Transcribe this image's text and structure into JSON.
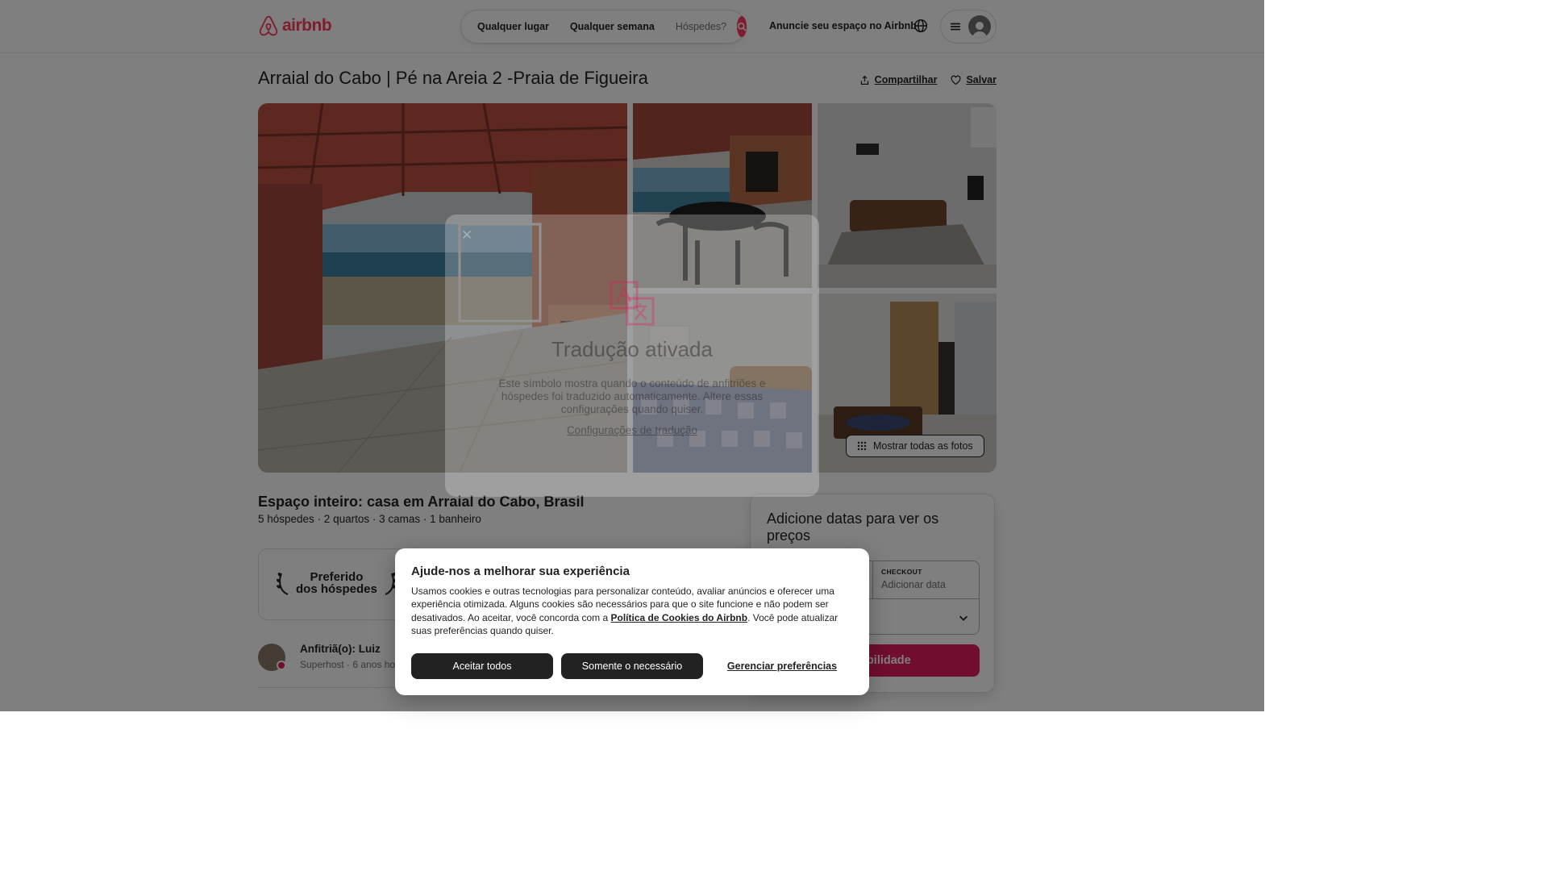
{
  "brand": {
    "name": "airbnb",
    "color": "#ff385c"
  },
  "search": {
    "where": "Qualquer lugar",
    "when": "Qualquer semana",
    "guests": "Hóspedes?"
  },
  "header": {
    "host_link": "Anuncie seu espaço no Airbnb"
  },
  "listing": {
    "title": "Arraial do Cabo | Pé na Areia 2 -Praia de Figueira",
    "share": "Compartilhar",
    "save": "Salvar",
    "show_all_photos": "Mostrar todas as fotos",
    "type": "Espaço inteiro: casa em Arraial do Cabo, Brasil",
    "details": "5 hóspedes · 2 quartos · 3 camas · 1 banheiro",
    "favorite_badge_line1": "Preferido",
    "favorite_badge_line2": "dos hóspedes"
  },
  "host": {
    "name": "Anfitriã(o): Luiz",
    "meta": "Superhost · 6 anos hos"
  },
  "booking": {
    "title": "Adicione datas para ver os preços",
    "checkout_label": "CHECKOUT",
    "checkout_value": "Adicionar data",
    "button": "sponibilidade",
    "accent": "#e31c5f"
  },
  "translation_modal": {
    "title": "Tradução ativada",
    "body": "Este símbolo mostra quando o conteúdo de anfitriões e hóspedes foi traduzido automaticamente. Altere essas configurações quando quiser.",
    "link": "Configurações de tradução"
  },
  "cookie": {
    "title": "Ajude-nos a melhorar sua experiência",
    "body_before": "Usamos cookies e outras tecnologias para personalizar conteúdo, avaliar anúncios e oferecer uma experiência otimizada. Alguns cookies são necessários para que o site funcione e não podem ser desativados. Ao aceitar, você concorda com a ",
    "policy_link": "Política de Cookies do Airbnb",
    "body_after": ". Você pode atualizar suas preferências quando quiser.",
    "accept_all": "Aceitar todos",
    "only_necessary": "Somente o necessário",
    "manage": "Gerenciar preferências"
  }
}
